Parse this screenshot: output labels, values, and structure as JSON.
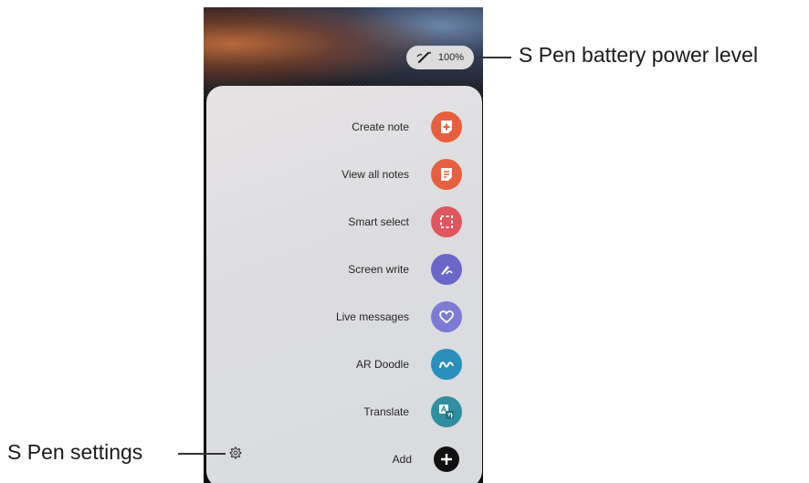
{
  "battery": {
    "level_text": "100%",
    "icon": "s-pen-icon"
  },
  "menu": {
    "items": [
      {
        "label": "Create note",
        "icon": "create-note-icon",
        "color": "#e7603d"
      },
      {
        "label": "View all notes",
        "icon": "view-notes-icon",
        "color": "#e7603d"
      },
      {
        "label": "Smart select",
        "icon": "smart-select-icon",
        "color": "#e0555e"
      },
      {
        "label": "Screen write",
        "icon": "screen-write-icon",
        "color": "#6b67c9"
      },
      {
        "label": "Live messages",
        "icon": "live-messages-icon",
        "color": "#7e7bd6"
      },
      {
        "label": "AR Doodle",
        "icon": "ar-doodle-icon",
        "color": "#2a8fbd"
      },
      {
        "label": "Translate",
        "icon": "translate-icon",
        "color": "#2f8fa0"
      },
      {
        "label": "Add",
        "icon": "add-icon",
        "color": "#111111"
      }
    ],
    "settings_icon": "gear-icon"
  },
  "callouts": {
    "battery_label": "S Pen battery power level",
    "settings_label": "S Pen settings"
  }
}
